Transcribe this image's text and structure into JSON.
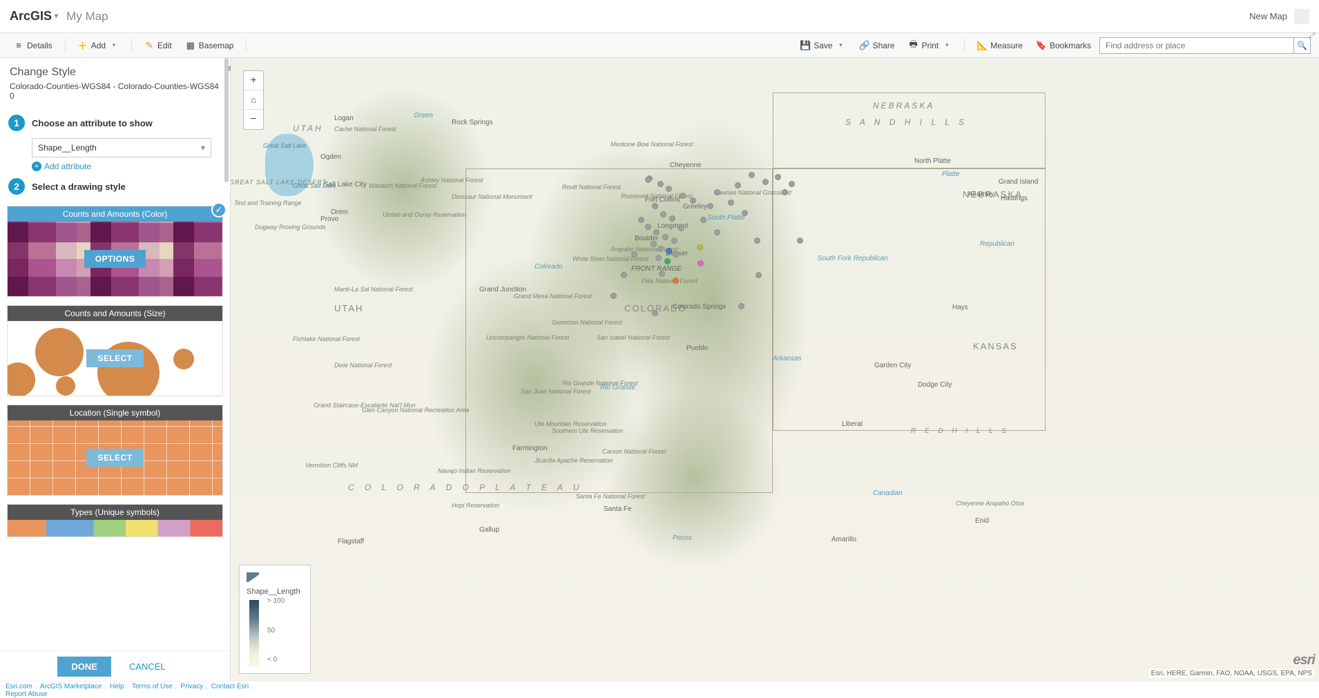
{
  "header": {
    "brand": "ArcGIS",
    "map_title": "My Map",
    "new_map": "New Map"
  },
  "toolbar": {
    "details": "Details",
    "add": "Add",
    "edit": "Edit",
    "basemap": "Basemap",
    "save": "Save",
    "share": "Share",
    "print": "Print",
    "measure": "Measure",
    "bookmarks": "Bookmarks",
    "search_placeholder": "Find address or place"
  },
  "panel": {
    "title": "Change Style",
    "layer": "Colorado-Counties-WGS84 - Colorado-Counties-WGS84 0",
    "step1_label": "Choose an attribute to show",
    "attribute_value": "Shape__Length",
    "add_attribute": "Add attribute",
    "step2_label": "Select a drawing style",
    "done": "DONE",
    "cancel": "CANCEL"
  },
  "styles": {
    "counts_color": {
      "title": "Counts and Amounts (Color)",
      "button": "OPTIONS"
    },
    "counts_size": {
      "title": "Counts and Amounts (Size)",
      "button": "SELECT"
    },
    "location": {
      "title": "Location (Single symbol)",
      "button": "SELECT"
    },
    "types": {
      "title": "Types (Unique symbols)",
      "button": ""
    }
  },
  "legend": {
    "field": "Shape__Length",
    "max": "> 100",
    "mid": "50",
    "min": "< 0"
  },
  "map": {
    "attribution": "Esri, HERE, Garmin, FAO, NOAA, USGS, EPA, NPS",
    "logo": "esri",
    "state_labels": {
      "utah": "UTAH",
      "colorado": "COLORADO",
      "nebraska": "NEBRASKA",
      "sand_hills": "S A N D   H I L L S",
      "kansas": "KANSAS",
      "colorado_plateau": "C O L O R A D O   P L A T E A U",
      "front_range": "FRONT RANGE",
      "red_hills": "R E D   H I L L S",
      "nebraska2": "NEBRASKA"
    },
    "cities": {
      "denver": "Denver",
      "boulder": "Boulder",
      "longmont": "Longmont",
      "fort_collins": "Fort Collins",
      "greeley": "Greeley",
      "cheyenne": "Cheyenne",
      "colorado_springs": "Colorado Springs",
      "pueblo": "Pueblo",
      "santa_fe": "Santa Fe",
      "grand_junction": "Grand Junction",
      "salt_lake": "Salt Lake City",
      "ogden": "Ogden",
      "provo": "Provo",
      "orem": "Orem",
      "logan": "Logan",
      "rock_springs": "Rock Springs",
      "farmington": "Farmington",
      "gallup": "Gallup",
      "north_platte": "North Platte",
      "kearney": "Kearney",
      "hastings": "Hastings",
      "grand_island": "Grand Island",
      "garden_city": "Garden City",
      "dodge_city": "Dodge City",
      "liberal": "Liberal",
      "hays": "Hays",
      "enid": "Enid",
      "amarillo": "Amarillo",
      "flagstaff": "Flagstaff"
    },
    "forests": {
      "cache": "Cache National Forest",
      "wasatch": "Wasatch National Forest",
      "ashley": "Ashley National Forest",
      "uintah": "Uintah and Ouray Reservation",
      "dinosaur": "Dinosaur National Monument",
      "manti": "Manti-La Sal National Forest",
      "fishlake": "Fishlake National Forest",
      "dixie": "Dixie National Forest",
      "grand_mesa": "Grand Mesa National Forest",
      "uncompahgre": "Uncompahgre National Forest",
      "gunnison": "Gunnison National Forest",
      "san_juan": "San Juan National Forest",
      "rio_grande": "Rio Grande National Forest",
      "white_river": "White River National Forest",
      "pike": "Pike National Forest",
      "san_isabel": "San Isabel National Forest",
      "arapaho": "Arapaho National Forest",
      "roosevelt": "Roosevelt National Forest",
      "routt": "Routt National Forest",
      "medicine_bow": "Medicine Bow National Forest",
      "pawnee": "Pawnee National Grassland",
      "grand_canyon": "Glen Canyon National Recreation Area",
      "navajo": "Navajo Indian Reservation",
      "hopi": "Hopi Reservation",
      "ute_mtn": "Ute Mountain Reservation",
      "southern_ute": "Southern Ute Reservation",
      "jicarilla": "Jicarilla Apache Reservation",
      "carson": "Carson National Forest",
      "santa_fe_nf": "Santa Fe National Forest",
      "cheyenne_arapaho": "Cheyenne Arapaho Otsa",
      "glen_staircase": "Grand Staircase-Escalante Nat'l Mon",
      "vermilion": "Vermilion Cliffs NM",
      "great_salt": "Great Salt Lake",
      "great_salt2": "Great Salt Lake",
      "dugway": "Dugway Proving Grounds",
      "test_range": "Test and Training Range",
      "great_salt_desert": "GREAT SALT LAKE DESERT"
    },
    "rivers": {
      "south_platte": "South Platte",
      "platte": "Platte",
      "republican": "Republican",
      "south_fork": "South Fork Republican",
      "arkansas": "Arkansas",
      "canadian": "Canadian",
      "colorado": "Colorado",
      "rio_grande": "Rio Grande",
      "green": "Green",
      "pecos": "Pecos"
    }
  },
  "footer": {
    "links": [
      "Esri.com",
      "ArcGIS Marketplace",
      "Help",
      "Terms of Use",
      "Privacy",
      "Contact Esri"
    ],
    "report": "Report Abuse"
  }
}
